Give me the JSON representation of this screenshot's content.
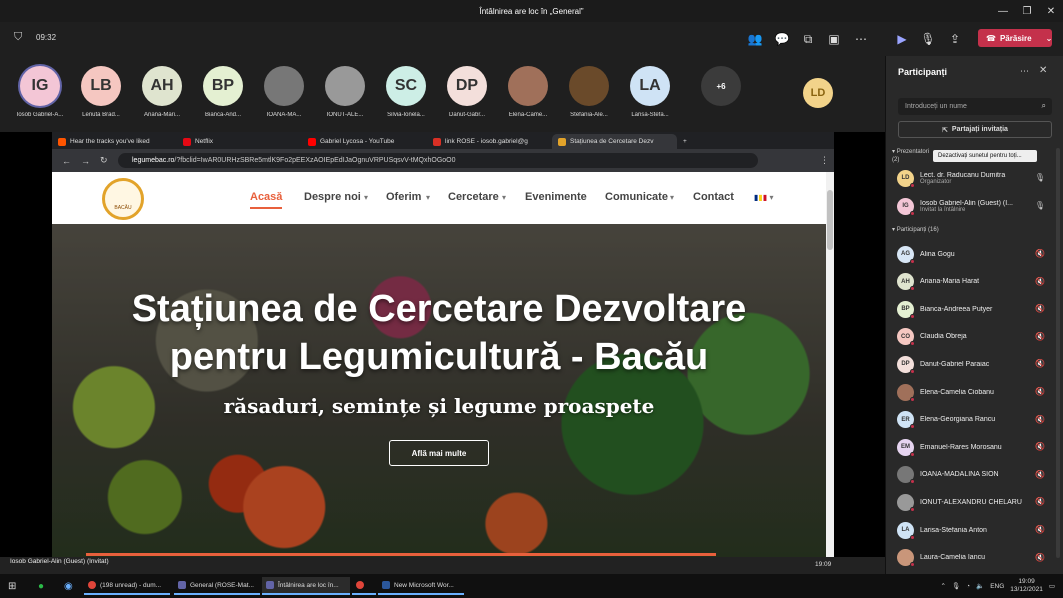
{
  "window": {
    "title": "Întâlnirea are loc în „General”",
    "ctl": [
      "—",
      "❐",
      "✕"
    ]
  },
  "meeting": {
    "timer": "09:32",
    "leave_label": "Părăsire",
    "strip": [
      {
        "initials": "IG",
        "name": "Iosob Gabriel-A...",
        "color": "#f3c6d6"
      },
      {
        "initials": "LB",
        "name": "Lenuta Brad...",
        "color": "#f5c7c1"
      },
      {
        "initials": "AH",
        "name": "Ariana-Mari...",
        "color": "#dfe4cf"
      },
      {
        "initials": "BP",
        "name": "Bianca-And...",
        "color": "#e4f0d2"
      },
      {
        "initials": "",
        "name": "IOANA-MA...",
        "color": "#777"
      },
      {
        "initials": "",
        "name": "IONUT-ALE...",
        "color": "#999"
      },
      {
        "initials": "SC",
        "name": "Silvia-Ionela...",
        "color": "#cdeee6"
      },
      {
        "initials": "DP",
        "name": "Danut-Gabr...",
        "color": "#f3dfdb"
      },
      {
        "initials": "",
        "name": "Elena-Came...",
        "color": "#a0705a"
      },
      {
        "initials": "",
        "name": "Stefania-Ale...",
        "color": "#6a4a2a"
      },
      {
        "initials": "LA",
        "name": "Larisa-Stefa...",
        "color": "#cfe3f5"
      }
    ],
    "more_count": "+6",
    "big_avatar": "LD"
  },
  "browser": {
    "tabs": [
      {
        "label": "Hear the tracks you've liked",
        "color": "#ff5500"
      },
      {
        "label": "Netflix",
        "color": "#e50914"
      },
      {
        "label": "Gabriel Lycosa - YouTube",
        "color": "#ff0000"
      },
      {
        "label": "link ROSE - iosob.gabriel@g",
        "color": "#d93025"
      },
      {
        "label": "Stațiunea de Cercetare Dezv",
        "color": "#e2a32a"
      }
    ],
    "new_tab": "+",
    "url_domain": "legumebac.ro",
    "url_rest": "/?fbclid=IwAR0URHzSBRe5mtlK9Fo2pEEXzAOIEpEdIJaOgnuVRPUSqsvV-tMQxhOGoO0"
  },
  "site": {
    "logo_text": "BACĂU",
    "nav": [
      "Acasă",
      "Despre noi",
      "Oferim",
      "Cercetare",
      "Evenimente",
      "Comunicate",
      "Contact"
    ],
    "hero_title_1": "Stațiunea de Cercetare Dezvoltare",
    "hero_title_2": "pentru Legumicultură - Bacău",
    "hero_subtitle": "răsaduri, semințe și legume proaspete",
    "cta": "Află mai multe"
  },
  "presenter": {
    "name": "Iosob Gabriel-Alin (Guest) (Invitat)",
    "time": "19:09"
  },
  "panel": {
    "title": "Participanți",
    "search_placeholder": "Introduceți un nume",
    "invite_label": "Partajați invitația",
    "presenters_label": "Prezentatori (2)",
    "tooltip": "Dezactivați sunetul pentru toți...",
    "presenters": [
      {
        "initials": "LD",
        "name": "Lect. dr. Raducanu Dumitra",
        "sub": "Organizator",
        "color": "#f2d38a"
      },
      {
        "initials": "IG",
        "name": "Iosob Gabriel-Alin (Guest) (I...",
        "sub": "Invitat la întâlnire",
        "color": "#f3c6d6"
      }
    ],
    "participants_label": "Participanți (16)",
    "participants": [
      {
        "initials": "AG",
        "name": "Alina Gogu",
        "color": "#d7e6f5"
      },
      {
        "initials": "AH",
        "name": "Ariana-Maria Harat",
        "color": "#dfe4cf"
      },
      {
        "initials": "BP",
        "name": "Bianca-Andreea Putyer",
        "color": "#e4f0d2"
      },
      {
        "initials": "CO",
        "name": "Claudia Obreja",
        "color": "#f5c7c1"
      },
      {
        "initials": "DP",
        "name": "Danut-Gabriel Paraiac",
        "color": "#f3dfdb"
      },
      {
        "initials": "",
        "name": "Elena-Camelia Ciobanu",
        "color": "#a0705a"
      },
      {
        "initials": "ER",
        "name": "Elena-Georgiana Rancu",
        "color": "#cfe3f5"
      },
      {
        "initials": "EM",
        "name": "Emanuel-Rares Morosanu",
        "color": "#e6d4f0"
      },
      {
        "initials": "",
        "name": "IOANA-MADALINA SION",
        "color": "#777"
      },
      {
        "initials": "",
        "name": "IONUT-ALEXANDRU CHELARU",
        "color": "#999"
      },
      {
        "initials": "LA",
        "name": "Larisa-Stefania Anton",
        "color": "#cfe3f5"
      },
      {
        "initials": "",
        "name": "Laura-Camelia Iancu",
        "color": "#c9967a"
      }
    ]
  },
  "taskbar": {
    "items": [
      "(198 unread) - dum...",
      "General (ROSE-Mat...",
      "Întâlnirea are loc în...",
      "",
      "New Microsoft Wor..."
    ],
    "lang": "ENG",
    "time": "19:09",
    "date": "13/12/2021"
  }
}
